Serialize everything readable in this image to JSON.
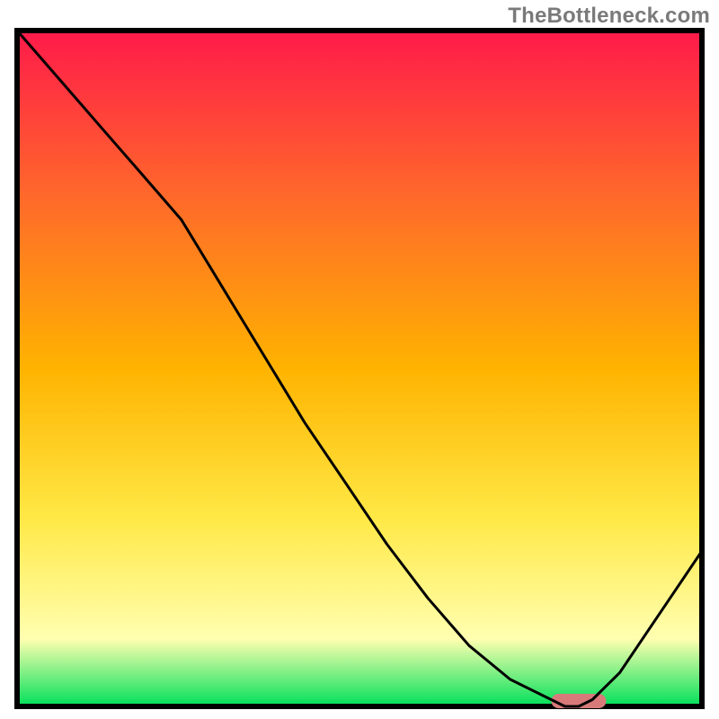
{
  "watermark": "TheBottleneck.com",
  "colors": {
    "gradient_top": "#ff1a4a",
    "gradient_q1": "#ff6a2a",
    "gradient_mid": "#ffb300",
    "gradient_q3": "#ffe845",
    "gradient_pale": "#ffffb0",
    "gradient_bottom": "#00e05a",
    "border": "#000000",
    "curve": "#000000",
    "marker": "#d97a7a"
  },
  "chart_data": {
    "type": "line",
    "title": "",
    "xlabel": "",
    "ylabel": "",
    "xlim": [
      0,
      100
    ],
    "ylim": [
      0,
      100
    ],
    "grid": false,
    "legend": false,
    "series": [
      {
        "name": "bottleneck-curve",
        "x": [
          0,
          6,
          12,
          18,
          24,
          30,
          36,
          42,
          48,
          54,
          60,
          66,
          72,
          78,
          80,
          82,
          84,
          88,
          92,
          96,
          100
        ],
        "y": [
          100,
          93,
          86,
          79,
          72,
          62,
          52,
          42,
          33,
          24,
          16,
          9,
          4,
          1,
          0,
          0,
          1,
          5,
          11,
          17,
          23
        ]
      }
    ],
    "annotations": [
      {
        "name": "optimal-marker",
        "shape": "rounded-bar",
        "x_range": [
          78,
          86
        ],
        "y": 0
      }
    ]
  }
}
